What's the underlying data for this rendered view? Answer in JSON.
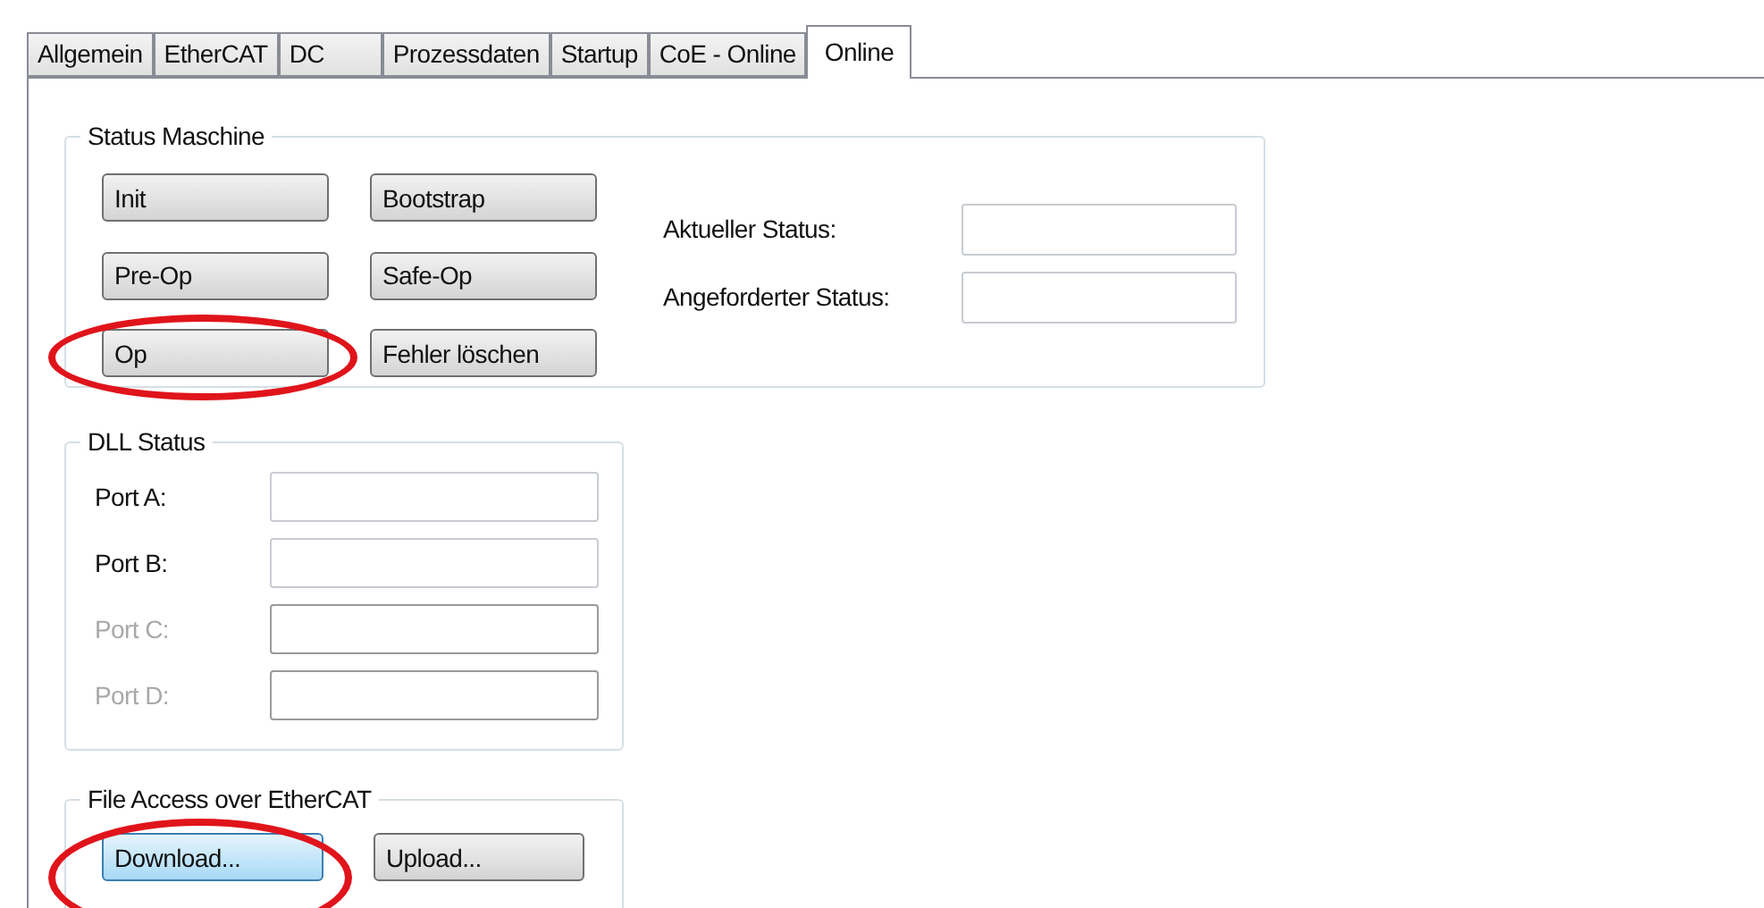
{
  "tabs": [
    {
      "label": "Allgemein",
      "selected": false
    },
    {
      "label": "EtherCAT",
      "selected": false
    },
    {
      "label": "DC",
      "selected": false
    },
    {
      "label": "Prozessdaten",
      "selected": false
    },
    {
      "label": "Startup",
      "selected": false
    },
    {
      "label": "CoE - Online",
      "selected": false
    },
    {
      "label": "Online",
      "selected": true
    }
  ],
  "status_machine": {
    "title": "Status Maschine",
    "buttons": [
      {
        "label": "Init",
        "highlighted": false
      },
      {
        "label": "Bootstrap",
        "highlighted": false
      },
      {
        "label": "Pre-Op",
        "highlighted": false
      },
      {
        "label": "Safe-Op",
        "highlighted": false
      },
      {
        "label": "Op",
        "highlighted": true
      },
      {
        "label": "Fehler löschen",
        "highlighted": false
      }
    ],
    "fields": [
      {
        "label": "Aktueller Status:"
      },
      {
        "label": "Angeforderter Status:"
      }
    ]
  },
  "dll_status": {
    "title": "DLL Status",
    "ports": [
      {
        "label": "Port A:",
        "disabled": false
      },
      {
        "label": "Port B:",
        "disabled": false
      },
      {
        "label": "Port C:",
        "disabled": true
      },
      {
        "label": "Port D:",
        "disabled": true
      }
    ]
  },
  "file_access": {
    "title": "File Access over EtherCAT",
    "buttons": [
      {
        "label": "Download...",
        "focused": true,
        "highlighted": true
      },
      {
        "label": "Upload...",
        "focused": false,
        "highlighted": false
      }
    ]
  }
}
